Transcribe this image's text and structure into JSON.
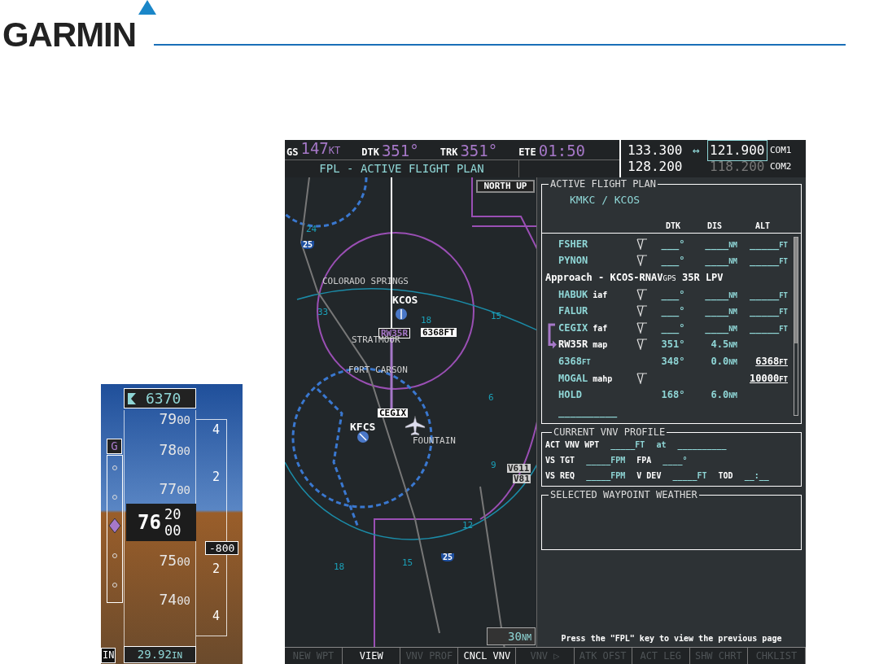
{
  "header": {
    "logo": "GARMIN"
  },
  "altimeter": {
    "selected_altitude": "6370",
    "glideslope_flag": "G",
    "tape_labels": [
      {
        "major": "79",
        "minor": "00"
      },
      {
        "major": "78",
        "minor": "00"
      },
      {
        "major": "77",
        "minor": "00"
      },
      {
        "major": "75",
        "minor": "00"
      },
      {
        "major": "74",
        "minor": "00"
      }
    ],
    "vsi_labels": [
      "4",
      "2",
      "2",
      "4"
    ],
    "current": {
      "major": "76",
      "upper": "20",
      "lower": "00"
    },
    "vertical_speed": "-800",
    "baro": "29.92",
    "baro_unit": "IN",
    "clipped_left": "IN"
  },
  "mfd": {
    "nav_fields": [
      {
        "label": "GS",
        "value": "147",
        "unit": "KT"
      },
      {
        "label": "DTK",
        "value": "351°"
      },
      {
        "label": "TRK",
        "value": "351°"
      },
      {
        "label": "ETE",
        "value": "01:50"
      }
    ],
    "page_title": "FPL - ACTIVE FLIGHT PLAN",
    "com": [
      {
        "active": "133.300",
        "swap": "↔",
        "standby": "121.900",
        "standby_selected": true,
        "label": "COM1"
      },
      {
        "active": "128.200",
        "standby": "118.200",
        "standby_selected": false,
        "label": "COM2"
      }
    ],
    "map": {
      "orientation": "NORTH UP",
      "range": "30",
      "range_unit": "NM",
      "labels": [
        {
          "text": "COLORADO SPRINGS",
          "kind": "city"
        },
        {
          "text": "KCOS",
          "kind": "airport"
        },
        {
          "text": "RW35R",
          "kind": "waypoint_active"
        },
        {
          "text": "6368FT",
          "kind": "waypoint"
        },
        {
          "text": "STRATMOOR",
          "kind": "city"
        },
        {
          "text": "FORT CARSON",
          "kind": "city"
        },
        {
          "text": "CEGIX",
          "kind": "waypoint"
        },
        {
          "text": "KFCS",
          "kind": "airport"
        },
        {
          "text": "FOUNTAIN",
          "kind": "city"
        },
        {
          "text": "V611",
          "kind": "airway"
        },
        {
          "text": "V81",
          "kind": "airway"
        },
        {
          "text": "25",
          "kind": "highway"
        },
        {
          "text": "25",
          "kind": "highway"
        }
      ],
      "ring_labels": [
        "24",
        "33",
        "18",
        "15",
        "6",
        "9",
        "12",
        "15",
        "18"
      ]
    },
    "flight_plan": {
      "title": "ACTIVE FLIGHT PLAN",
      "route": "KMKC / KCOS",
      "columns": [
        "DTK",
        "DIS",
        "ALT"
      ],
      "legs": [
        {
          "kind": "leg",
          "name": "FSHER",
          "leg_icon": true,
          "dtk": "___°",
          "dis": "____",
          "dis_unit": "NM",
          "alt": "_____",
          "alt_unit": "FT",
          "alt_set": false,
          "active": false
        },
        {
          "kind": "leg",
          "name": "PYNON",
          "leg_icon": true,
          "dtk": "___°",
          "dis": "____",
          "dis_unit": "NM",
          "alt": "_____",
          "alt_unit": "FT",
          "alt_set": false,
          "active": false
        },
        {
          "kind": "header",
          "text": "Approach - KCOS-RNAV",
          "small": "GPS",
          "rest": "35R LPV"
        },
        {
          "kind": "leg",
          "name": "HABUK",
          "role": "iaf",
          "leg_icon": true,
          "dtk": "___°",
          "dis": "____",
          "dis_unit": "NM",
          "alt": "_____",
          "alt_unit": "FT",
          "alt_set": false,
          "active": false
        },
        {
          "kind": "leg",
          "name": "FALUR",
          "leg_icon": true,
          "dtk": "___°",
          "dis": "____",
          "dis_unit": "NM",
          "alt": "_____",
          "alt_unit": "FT",
          "alt_set": false,
          "active": false
        },
        {
          "kind": "leg",
          "name": "CEGIX",
          "role": "faf",
          "leg_icon": true,
          "dtk": "___°",
          "dis": "____",
          "dis_unit": "NM",
          "alt": "_____",
          "alt_unit": "FT",
          "alt_set": false,
          "active": false
        },
        {
          "kind": "leg",
          "name": "RW35R",
          "role": "map",
          "leg_icon": true,
          "dtk": "351°",
          "dis": "4.5",
          "dis_unit": "NM",
          "active": true
        },
        {
          "kind": "leg",
          "name": "6368",
          "name_unit": "FT",
          "leg_icon": false,
          "dtk": "348°",
          "dis": "0.0",
          "dis_unit": "NM",
          "alt": "6368",
          "alt_unit": "FT",
          "alt_set": true,
          "active": false
        },
        {
          "kind": "leg",
          "name": "MOGAL",
          "role": "mahp",
          "leg_icon": true,
          "alt": "10000",
          "alt_unit": "FT",
          "alt_set": true,
          "active": false
        },
        {
          "kind": "leg",
          "name": "HOLD",
          "leg_icon": false,
          "dtk": "168°",
          "dis": "6.0",
          "dis_unit": "NM",
          "active": false
        },
        {
          "kind": "leg",
          "name": "__________",
          "leg_icon": false,
          "active": false
        }
      ]
    },
    "vnv_profile": {
      "title": "CURRENT VNV PROFILE",
      "rows": [
        [
          {
            "kind": "label",
            "text": "ACT VNV WPT"
          },
          {
            "kind": "value",
            "text": "_____FT"
          },
          {
            "kind": "value",
            "text": "at"
          },
          {
            "kind": "value",
            "text": "__________"
          }
        ],
        [
          {
            "kind": "label",
            "text": "VS TGT"
          },
          {
            "kind": "value",
            "text": "_____FPM"
          },
          {
            "kind": "label",
            "text": "FPA"
          },
          {
            "kind": "value",
            "text": "____°"
          }
        ],
        [
          {
            "kind": "label",
            "text": "VS REQ"
          },
          {
            "kind": "value",
            "text": "_____FPM"
          },
          {
            "kind": "label",
            "text": "V DEV"
          },
          {
            "kind": "value",
            "text": "_____FT"
          },
          {
            "kind": "label",
            "text": "TOD"
          },
          {
            "kind": "value",
            "text": "__:__"
          }
        ]
      ]
    },
    "weather": {
      "title": "SELECTED WAYPOINT WEATHER"
    },
    "hint": "Press the \"FPL\" key to view the previous page",
    "softkeys": [
      {
        "label": "NEW WPT",
        "disabled": true
      },
      {
        "label": "VIEW",
        "disabled": false
      },
      {
        "label": "VNV PROF",
        "disabled": true
      },
      {
        "label": "CNCL VNV",
        "disabled": false
      },
      {
        "label": "VNV ▷",
        "disabled": true
      },
      {
        "label": "ATK OFST",
        "disabled": true
      },
      {
        "label": "ACT LEG",
        "disabled": true
      },
      {
        "label": "SHW CHRT",
        "disabled": true
      },
      {
        "label": "CHKLIST",
        "disabled": true
      }
    ]
  }
}
